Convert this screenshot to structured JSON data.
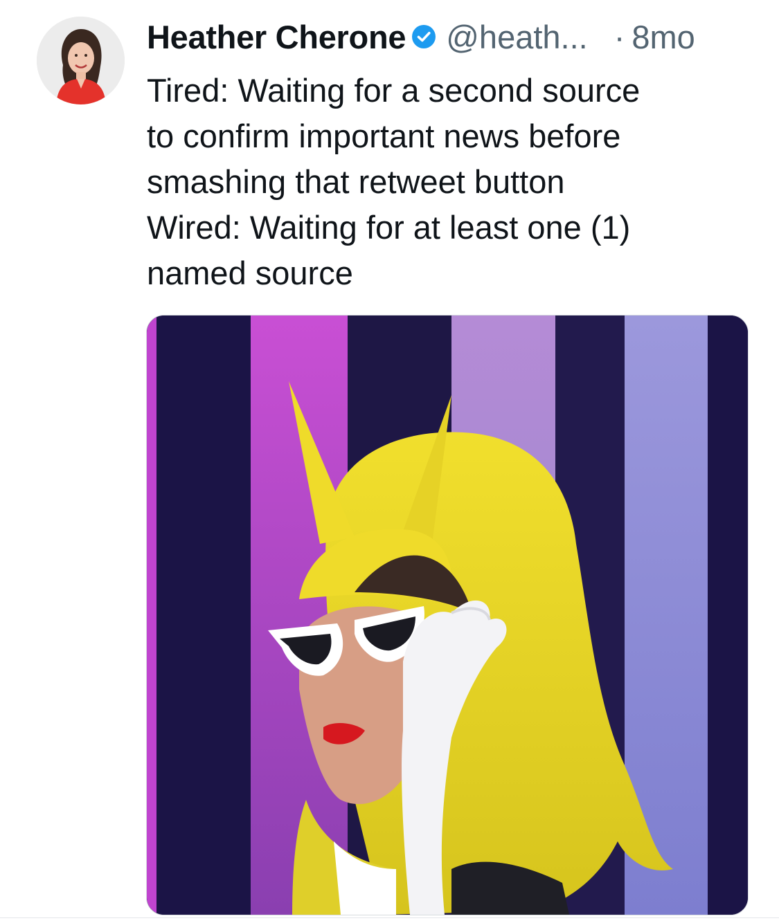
{
  "tweet": {
    "author_name": "Heather Cherone",
    "handle": "@heath...",
    "separator": "·",
    "timestamp": "8mo",
    "text_lines": [
      "Tired: Waiting for a second source",
      "to confirm important news before",
      "smashing that retweet button",
      "Wired: Waiting for at least one (1)",
      "named source"
    ],
    "avatar_icon": "profile-photo",
    "verified_icon": "verified-badge-icon",
    "media_description_icon": "gif-media"
  },
  "colors": {
    "text_primary": "#0f1419",
    "text_secondary": "#536471",
    "verified_blue": "#1d9bf0",
    "background": "#ffffff"
  }
}
